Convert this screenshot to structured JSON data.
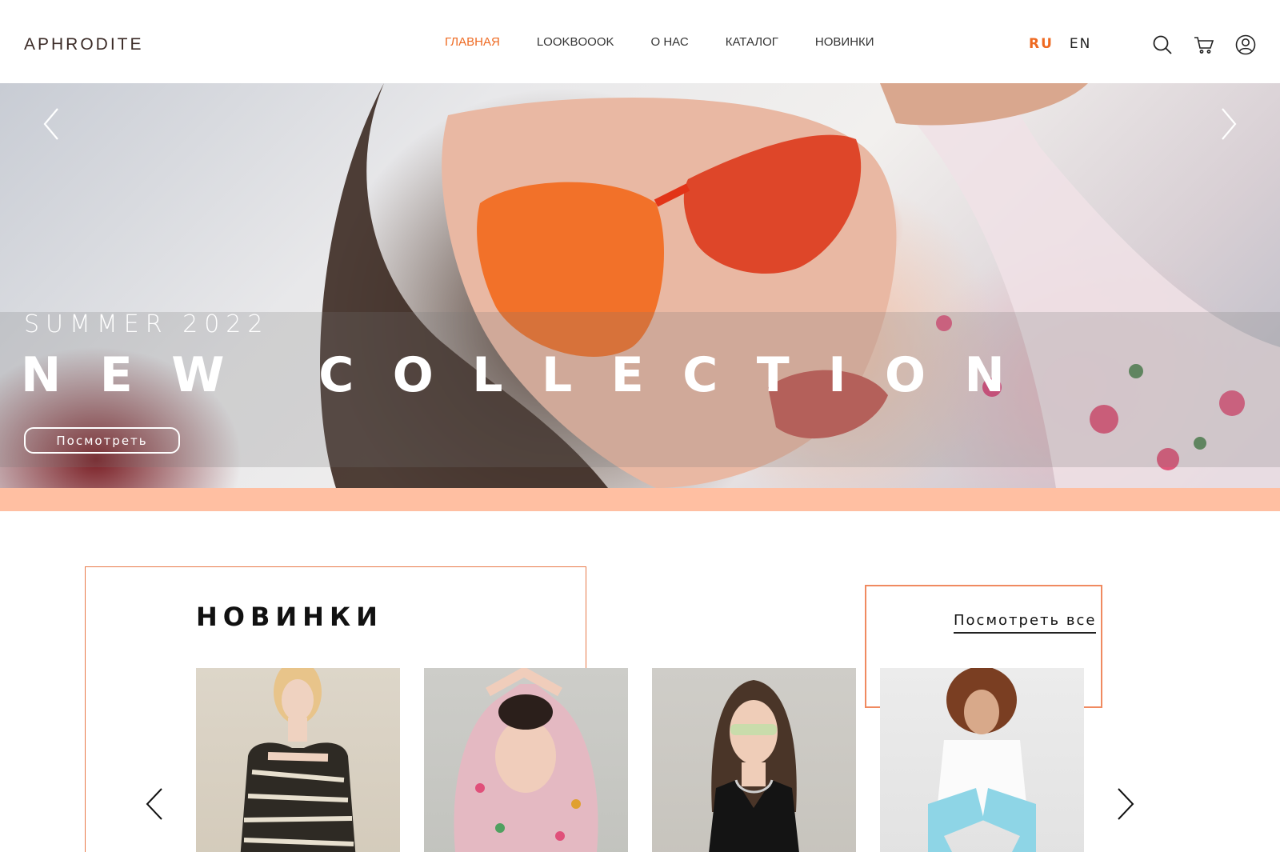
{
  "header": {
    "logo": "APHRODITE",
    "nav": [
      {
        "label": "ГЛАВНАЯ",
        "active": true
      },
      {
        "label": "LOOKBOOOK",
        "active": false
      },
      {
        "label": "О НАС",
        "active": false
      },
      {
        "label": "КАТАЛОГ",
        "active": false
      },
      {
        "label": "НОВИНКИ",
        "active": false
      }
    ],
    "languages": [
      {
        "label": "RU",
        "active": true
      },
      {
        "label": "EN",
        "active": false
      }
    ],
    "icons": [
      "search-icon",
      "cart-icon",
      "user-icon"
    ]
  },
  "hero": {
    "subtitle": "SUMMER 2022",
    "title": "NEW COLLECTION",
    "button_label": "Посмотреть"
  },
  "new_arrivals": {
    "title": "НОВИНКИ",
    "view_all_label": "Посмотреть все",
    "products": [
      {
        "image": "zebra-print-dress"
      },
      {
        "image": "floral-blouse"
      },
      {
        "image": "black-tank-top"
      },
      {
        "image": "white-shirt-blue-pants"
      }
    ]
  },
  "colors": {
    "accent": "#ee6a22",
    "peach_strip": "#ffbfa2",
    "frame": "#f08a60"
  }
}
